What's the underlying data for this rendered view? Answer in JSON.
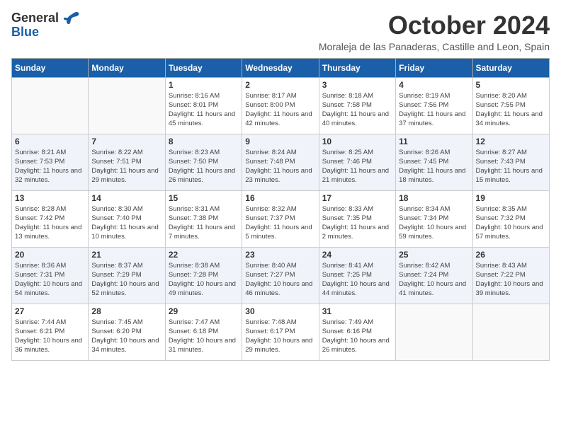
{
  "logo": {
    "general": "General",
    "blue": "Blue"
  },
  "title": "October 2024",
  "subtitle": "Moraleja de las Panaderas, Castille and Leon, Spain",
  "days_of_week": [
    "Sunday",
    "Monday",
    "Tuesday",
    "Wednesday",
    "Thursday",
    "Friday",
    "Saturday"
  ],
  "weeks": [
    [
      {
        "day": "",
        "info": ""
      },
      {
        "day": "",
        "info": ""
      },
      {
        "day": "1",
        "info": "Sunrise: 8:16 AM\nSunset: 8:01 PM\nDaylight: 11 hours and 45 minutes."
      },
      {
        "day": "2",
        "info": "Sunrise: 8:17 AM\nSunset: 8:00 PM\nDaylight: 11 hours and 42 minutes."
      },
      {
        "day": "3",
        "info": "Sunrise: 8:18 AM\nSunset: 7:58 PM\nDaylight: 11 hours and 40 minutes."
      },
      {
        "day": "4",
        "info": "Sunrise: 8:19 AM\nSunset: 7:56 PM\nDaylight: 11 hours and 37 minutes."
      },
      {
        "day": "5",
        "info": "Sunrise: 8:20 AM\nSunset: 7:55 PM\nDaylight: 11 hours and 34 minutes."
      }
    ],
    [
      {
        "day": "6",
        "info": "Sunrise: 8:21 AM\nSunset: 7:53 PM\nDaylight: 11 hours and 32 minutes."
      },
      {
        "day": "7",
        "info": "Sunrise: 8:22 AM\nSunset: 7:51 PM\nDaylight: 11 hours and 29 minutes."
      },
      {
        "day": "8",
        "info": "Sunrise: 8:23 AM\nSunset: 7:50 PM\nDaylight: 11 hours and 26 minutes."
      },
      {
        "day": "9",
        "info": "Sunrise: 8:24 AM\nSunset: 7:48 PM\nDaylight: 11 hours and 23 minutes."
      },
      {
        "day": "10",
        "info": "Sunrise: 8:25 AM\nSunset: 7:46 PM\nDaylight: 11 hours and 21 minutes."
      },
      {
        "day": "11",
        "info": "Sunrise: 8:26 AM\nSunset: 7:45 PM\nDaylight: 11 hours and 18 minutes."
      },
      {
        "day": "12",
        "info": "Sunrise: 8:27 AM\nSunset: 7:43 PM\nDaylight: 11 hours and 15 minutes."
      }
    ],
    [
      {
        "day": "13",
        "info": "Sunrise: 8:28 AM\nSunset: 7:42 PM\nDaylight: 11 hours and 13 minutes."
      },
      {
        "day": "14",
        "info": "Sunrise: 8:30 AM\nSunset: 7:40 PM\nDaylight: 11 hours and 10 minutes."
      },
      {
        "day": "15",
        "info": "Sunrise: 8:31 AM\nSunset: 7:38 PM\nDaylight: 11 hours and 7 minutes."
      },
      {
        "day": "16",
        "info": "Sunrise: 8:32 AM\nSunset: 7:37 PM\nDaylight: 11 hours and 5 minutes."
      },
      {
        "day": "17",
        "info": "Sunrise: 8:33 AM\nSunset: 7:35 PM\nDaylight: 11 hours and 2 minutes."
      },
      {
        "day": "18",
        "info": "Sunrise: 8:34 AM\nSunset: 7:34 PM\nDaylight: 10 hours and 59 minutes."
      },
      {
        "day": "19",
        "info": "Sunrise: 8:35 AM\nSunset: 7:32 PM\nDaylight: 10 hours and 57 minutes."
      }
    ],
    [
      {
        "day": "20",
        "info": "Sunrise: 8:36 AM\nSunset: 7:31 PM\nDaylight: 10 hours and 54 minutes."
      },
      {
        "day": "21",
        "info": "Sunrise: 8:37 AM\nSunset: 7:29 PM\nDaylight: 10 hours and 52 minutes."
      },
      {
        "day": "22",
        "info": "Sunrise: 8:38 AM\nSunset: 7:28 PM\nDaylight: 10 hours and 49 minutes."
      },
      {
        "day": "23",
        "info": "Sunrise: 8:40 AM\nSunset: 7:27 PM\nDaylight: 10 hours and 46 minutes."
      },
      {
        "day": "24",
        "info": "Sunrise: 8:41 AM\nSunset: 7:25 PM\nDaylight: 10 hours and 44 minutes."
      },
      {
        "day": "25",
        "info": "Sunrise: 8:42 AM\nSunset: 7:24 PM\nDaylight: 10 hours and 41 minutes."
      },
      {
        "day": "26",
        "info": "Sunrise: 8:43 AM\nSunset: 7:22 PM\nDaylight: 10 hours and 39 minutes."
      }
    ],
    [
      {
        "day": "27",
        "info": "Sunrise: 7:44 AM\nSunset: 6:21 PM\nDaylight: 10 hours and 36 minutes."
      },
      {
        "day": "28",
        "info": "Sunrise: 7:45 AM\nSunset: 6:20 PM\nDaylight: 10 hours and 34 minutes."
      },
      {
        "day": "29",
        "info": "Sunrise: 7:47 AM\nSunset: 6:18 PM\nDaylight: 10 hours and 31 minutes."
      },
      {
        "day": "30",
        "info": "Sunrise: 7:48 AM\nSunset: 6:17 PM\nDaylight: 10 hours and 29 minutes."
      },
      {
        "day": "31",
        "info": "Sunrise: 7:49 AM\nSunset: 6:16 PM\nDaylight: 10 hours and 26 minutes."
      },
      {
        "day": "",
        "info": ""
      },
      {
        "day": "",
        "info": ""
      }
    ]
  ]
}
